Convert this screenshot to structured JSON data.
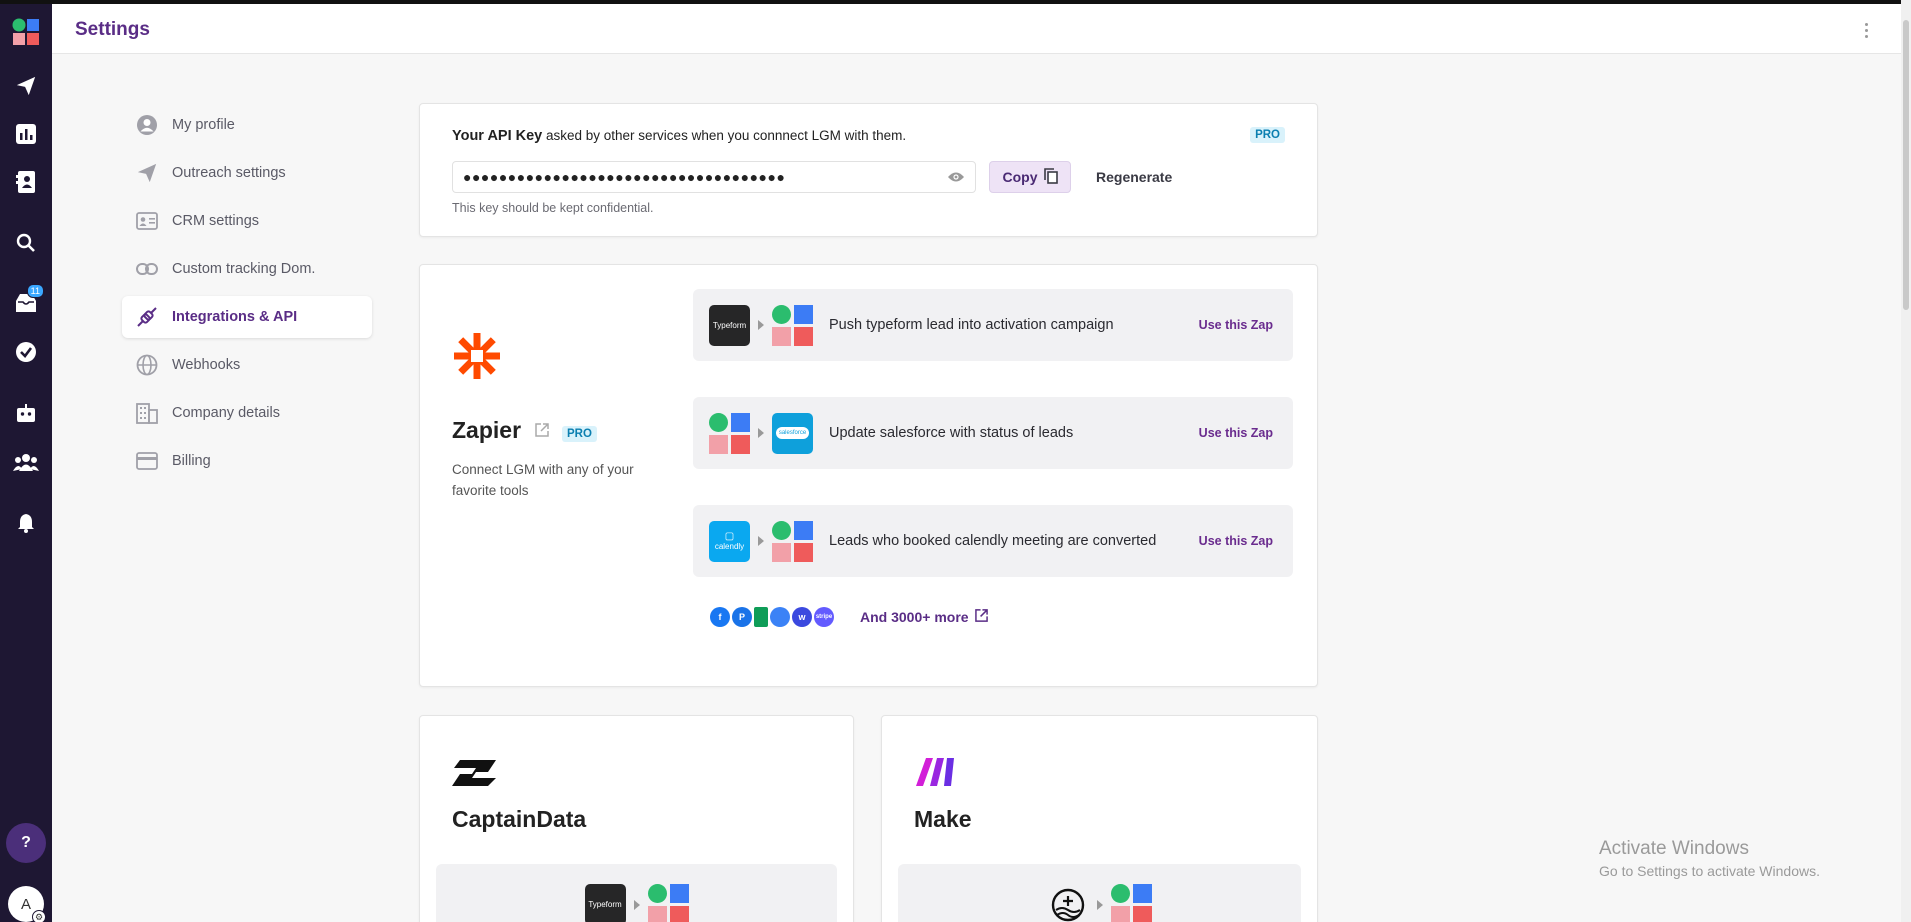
{
  "app": {
    "page_title": "Settings"
  },
  "rail": {
    "inbox_badge": "11",
    "help_label": "?",
    "avatar_initial": "A"
  },
  "nav": {
    "items": [
      {
        "label": "My profile",
        "icon": "user-circle-icon"
      },
      {
        "label": "Outreach settings",
        "icon": "paper-plane-icon"
      },
      {
        "label": "CRM settings",
        "icon": "id-card-icon"
      },
      {
        "label": "Custom tracking Dom.",
        "icon": "link-icon"
      },
      {
        "label": "Integrations & API",
        "icon": "plug-icon",
        "active": true
      },
      {
        "label": "Webhooks",
        "icon": "globe-icon"
      },
      {
        "label": "Company details",
        "icon": "building-icon"
      },
      {
        "label": "Billing",
        "icon": "credit-card-icon"
      }
    ]
  },
  "api": {
    "title_bold": "Your API Key",
    "title_rest": " asked by other services when you connnect LGM with them.",
    "badge": "PRO",
    "key_masked": "●●●●●●●●●●●●●●●●●●●●●●●●●●●●●●●●●●●●",
    "copy_label": "Copy",
    "regenerate_label": "Regenerate",
    "hint": "This key should be kept confidential."
  },
  "zapier": {
    "name": "Zapier",
    "badge": "PRO",
    "description": "Connect LGM with any of your favorite tools",
    "zaps": [
      {
        "from": "Typeform",
        "label": "Push typeform lead into activation campaign",
        "action": "Use this Zap"
      },
      {
        "to": "salesforce",
        "label": "Update salesforce with status of leads",
        "action": "Use this Zap"
      },
      {
        "from": "calendly",
        "label": "Leads who booked calendly meeting are converted",
        "action": "Use this Zap"
      }
    ],
    "more_label": "And 3000+ more",
    "mini_apps": [
      "f",
      "P",
      "",
      "",
      "w",
      "stripe"
    ]
  },
  "partners": {
    "captaindata": {
      "name": "CaptainData",
      "preview_app": "Typeform"
    },
    "make": {
      "name": "Make"
    }
  },
  "watermark": {
    "title": "Activate Windows",
    "subtitle": "Go to Settings to activate Windows."
  },
  "colors": {
    "brand_purple": "#5a2d86",
    "rail_bg": "#1e1733",
    "zapier_orange": "#ff4a00",
    "pro_bg": "#d9f2fb"
  }
}
